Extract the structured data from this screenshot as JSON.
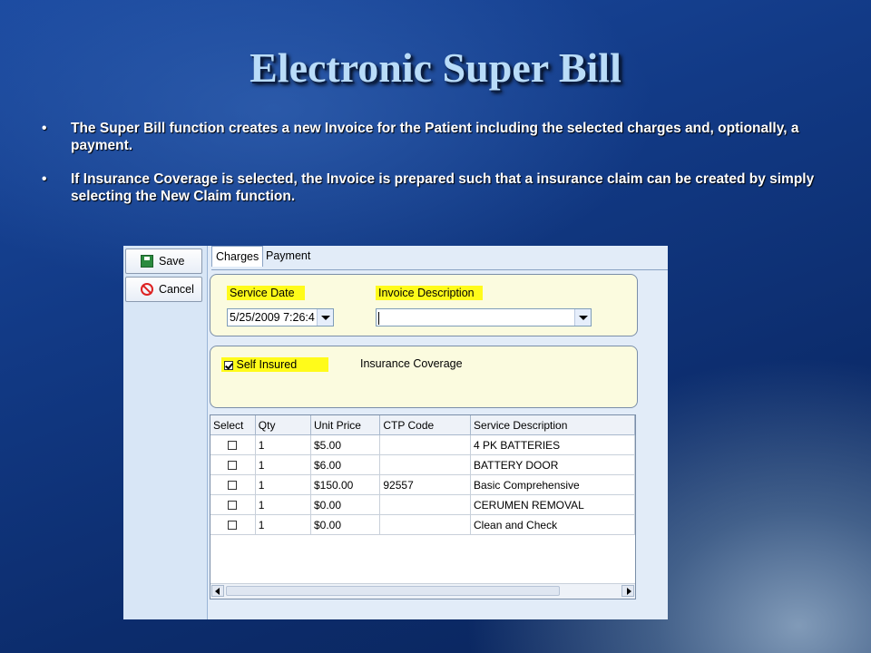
{
  "slide": {
    "title": "Electronic Super Bill",
    "bullets": [
      "The Super Bill function creates a new Invoice for the Patient including the selected charges and, optionally, a payment.",
      "If Insurance Coverage is selected, the Invoice is prepared such that a insurance claim can be created by simply selecting the New Claim function."
    ],
    "bullet_glyph": "•"
  },
  "toolbar": {
    "save_label": "Save",
    "cancel_label": "Cancel"
  },
  "tabs": [
    {
      "label": "Charges",
      "active": true
    },
    {
      "label": "Payment",
      "active": false
    }
  ],
  "service": {
    "date_label": "Service Date",
    "date_value": "5/25/2009 7:26:4",
    "invoice_label": "Invoice Description",
    "invoice_value": ""
  },
  "coverage": {
    "self_insured_label": "Self Insured",
    "self_insured_checked": true,
    "insurance_label": "Insurance Coverage"
  },
  "charges": {
    "columns": [
      "Select",
      "Qty",
      "Unit Price",
      "CTP Code",
      "Service Description"
    ],
    "rows": [
      {
        "select": false,
        "qty": "1",
        "unit_price": "$5.00",
        "ctp_code": "",
        "description": "4 PK BATTERIES"
      },
      {
        "select": false,
        "qty": "1",
        "unit_price": "$6.00",
        "ctp_code": "",
        "description": "BATTERY DOOR"
      },
      {
        "select": false,
        "qty": "1",
        "unit_price": "$150.00",
        "ctp_code": "92557",
        "description": "Basic Comprehensive"
      },
      {
        "select": false,
        "qty": "1",
        "unit_price": "$0.00",
        "ctp_code": "",
        "description": "CERUMEN REMOVAL"
      },
      {
        "select": false,
        "qty": "1",
        "unit_price": "$0.00",
        "ctp_code": "",
        "description": "Clean and Check"
      }
    ]
  },
  "colors": {
    "highlight": "#fffb1a",
    "title": "#b9dcf8",
    "background": "#123a86"
  }
}
